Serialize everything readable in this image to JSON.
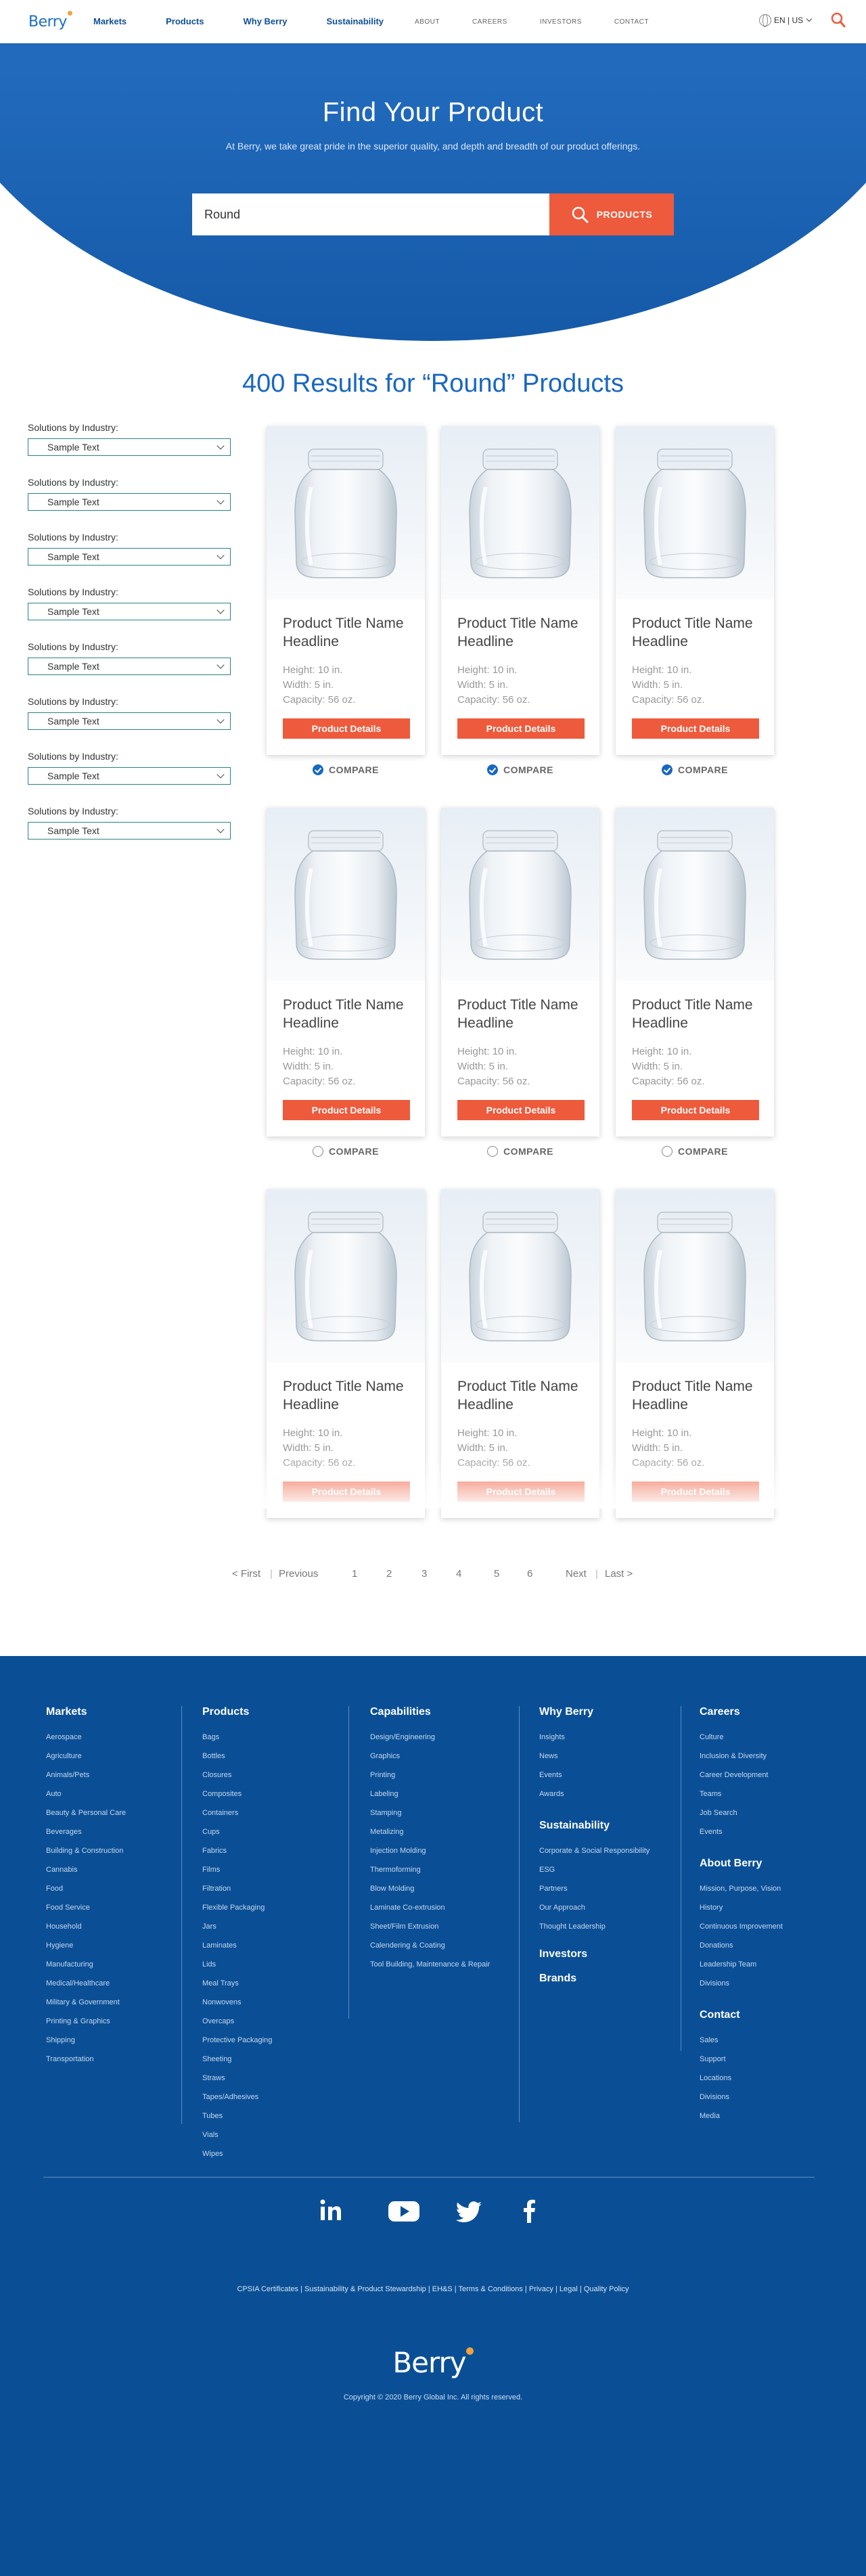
{
  "header": {
    "logo": "Berry",
    "main_nav": [
      "Markets",
      "Products",
      "Why Berry",
      "Sustainability"
    ],
    "secondary_nav": [
      "ABOUT",
      "CAREERS",
      "INVESTORS",
      "CONTACT"
    ],
    "language": "EN | US",
    "icons": [
      "globe-icon",
      "search-icon"
    ]
  },
  "hero": {
    "title": "Find Your Product",
    "subtitle": "At Berry, we take great pride in the superior quality, and depth and breadth of our product offerings.",
    "search_value": "Round",
    "search_button": "PRODUCTS"
  },
  "results": {
    "title": "400 Results for “Round” Products"
  },
  "filters": [
    {
      "label": "Solutions by Industry:",
      "value": "Sample Text"
    },
    {
      "label": "Solutions by Industry:",
      "value": "Sample Text"
    },
    {
      "label": "Solutions by Industry:",
      "value": "Sample Text"
    },
    {
      "label": "Solutions by Industry:",
      "value": "Sample Text"
    },
    {
      "label": "Solutions by Industry:",
      "value": "Sample Text"
    },
    {
      "label": "Solutions by Industry:",
      "value": "Sample Text"
    },
    {
      "label": "Solutions by Industry:",
      "value": "Sample Text"
    },
    {
      "label": "Solutions by Industry:",
      "value": "Sample Text"
    }
  ],
  "products": [
    {
      "title": "Product Title Name Headline",
      "height": "Height: 10 in.",
      "width": "Width: 5 in.",
      "capacity": "Capacity: 56 oz.",
      "button": "Product Details",
      "compare": "COMPARE",
      "compared": true
    },
    {
      "title": "Product Title Name Headline",
      "height": "Height: 10 in.",
      "width": "Width: 5 in.",
      "capacity": "Capacity: 56 oz.",
      "button": "Product Details",
      "compare": "COMPARE",
      "compared": true
    },
    {
      "title": "Product Title Name Headline",
      "height": "Height: 10 in.",
      "width": "Width: 5 in.",
      "capacity": "Capacity: 56 oz.",
      "button": "Product Details",
      "compare": "COMPARE",
      "compared": true
    },
    {
      "title": "Product Title Name Headline",
      "height": "Height: 10 in.",
      "width": "Width: 5 in.",
      "capacity": "Capacity: 56 oz.",
      "button": "Product Details",
      "compare": "COMPARE",
      "compared": false
    },
    {
      "title": "Product Title Name Headline",
      "height": "Height: 10 in.",
      "width": "Width: 5 in.",
      "capacity": "Capacity: 56 oz.",
      "button": "Product Details",
      "compare": "COMPARE",
      "compared": false
    },
    {
      "title": "Product Title Name Headline",
      "height": "Height: 10 in.",
      "width": "Width: 5 in.",
      "capacity": "Capacity: 56 oz.",
      "button": "Product Details",
      "compare": "COMPARE",
      "compared": false
    },
    {
      "title": "Product Title Name Headline",
      "height": "Height: 10 in.",
      "width": "Width: 5 in.",
      "capacity": "Capacity: 56 oz.",
      "button": "Product Details",
      "compare": "",
      "compared": false
    },
    {
      "title": "Product Title Name Headline",
      "height": "Height: 10 in.",
      "width": "Width: 5 in.",
      "capacity": "Capacity: 56 oz.",
      "button": "Product Details",
      "compare": "",
      "compared": false
    },
    {
      "title": "Product Title Name Headline",
      "height": "Height: 10 in.",
      "width": "Width: 5 in.",
      "capacity": "Capacity: 56 oz.",
      "button": "Product Details",
      "compare": "",
      "compared": false
    }
  ],
  "pagination": {
    "first": "< First",
    "previous": "Previous",
    "pages": [
      "1",
      "2",
      "3",
      "4",
      "5",
      "6"
    ],
    "next": "Next",
    "last": "Last >"
  },
  "footer": {
    "columns": [
      {
        "sections": [
          {
            "heading": "Markets",
            "items": [
              "Aerospace",
              "Agriculture",
              "Animals/Pets",
              "Auto",
              "Beauty & Personal Care",
              "Beverages",
              "Building & Construction",
              "Cannabis",
              "Food",
              "Food Service",
              "Household",
              "Hygiene",
              "Manufacturing",
              "Medical/Healthcare",
              "Military & Government",
              "Printing & Graphics",
              "Shipping",
              "Transportation"
            ]
          }
        ]
      },
      {
        "sections": [
          {
            "heading": "Products",
            "items": [
              "Bags",
              "Bottles",
              "Closures",
              "Composites",
              "Containers",
              "Cups",
              "Fabrics",
              "Films",
              "Filtration",
              "Flexible Packaging",
              "Jars",
              "Laminates",
              "Lids",
              "Meal Trays",
              "Nonwovens",
              "Overcaps",
              "Protective Packaging",
              "Sheeting",
              "Straws",
              "Tapes/Adhesives",
              "Tubes",
              "Vials",
              "Wipes"
            ]
          }
        ]
      },
      {
        "sections": [
          {
            "heading": "Capabilities",
            "items": [
              "Design/Engineering",
              "Graphics",
              "Printing",
              "Labeling",
              "Stamping",
              "Metalizing",
              "Injection Molding",
              "Thermoforming",
              "Blow Molding",
              "Laminate Co-extrusion",
              "Sheet/Film Extrusion",
              "Calendering & Coating",
              "Tool Building, Maintenance & Repair"
            ]
          }
        ]
      },
      {
        "sections": [
          {
            "heading": "Why Berry",
            "items": [
              "Insights",
              "News",
              "Events",
              "Awards"
            ]
          },
          {
            "heading": "Sustainability",
            "items": [
              "Corporate & Social Responsibility",
              "ESG",
              "Partners",
              "Our Approach",
              "Thought Leadership"
            ]
          },
          {
            "heading": "Investors",
            "items": []
          },
          {
            "heading": "Brands",
            "items": []
          }
        ]
      },
      {
        "sections": [
          {
            "heading": "Careers",
            "items": [
              "Culture",
              "Inclusion & Diversity",
              "Career Development",
              "Teams",
              "Job Search",
              "Events"
            ]
          },
          {
            "heading": "About Berry",
            "items": [
              "Mission, Purpose, Vision",
              "History",
              "Continuous Improvement",
              "Donations",
              "Leadership Team",
              "Divisions"
            ]
          },
          {
            "heading": "Contact",
            "items": [
              "Sales",
              "Support",
              "Locations",
              "Divisions",
              "Media"
            ]
          }
        ]
      }
    ],
    "social": [
      "linkedin-icon",
      "youtube-icon",
      "twitter-icon",
      "facebook-icon"
    ],
    "links": [
      "CPSIA Certificates",
      "Sustainability & Product Stewardship",
      "EH&S",
      "Terms & Conditions",
      "Privacy",
      "Legal",
      "Quality Policy"
    ],
    "logo": "Berry",
    "copyright": "Copyright © 2020 Berry Global Inc. All rights reserved."
  }
}
